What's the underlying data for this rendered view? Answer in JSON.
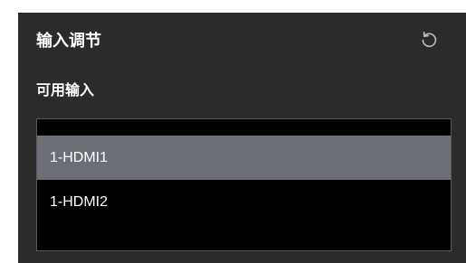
{
  "panel": {
    "title": "输入调节",
    "reset_icon": "reset-icon",
    "subtitle": "可用输入",
    "inputs": [
      {
        "label": "1-HDMI1",
        "selected": true
      },
      {
        "label": "1-HDMI2",
        "selected": false
      }
    ]
  },
  "colors": {
    "panel_background": "#2b2b2b",
    "list_background": "#000000",
    "selected_background": "#6b6f75",
    "text": "#ffffff"
  }
}
